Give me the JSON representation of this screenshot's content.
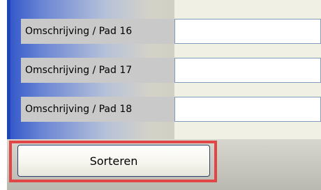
{
  "rows": [
    {
      "label": "Omschrijving / Pad 16",
      "value": ""
    },
    {
      "label": "Omschrijving / Pad 17",
      "value": ""
    },
    {
      "label": "Omschrijving / Pad 18",
      "value": ""
    }
  ],
  "footer": {
    "sort_label": "Sorteren"
  },
  "colors": {
    "accent_blue": "#1d45b8",
    "highlight_red": "#e04646",
    "label_bg": "#c9c9c9",
    "input_border": "#7f9db9"
  }
}
